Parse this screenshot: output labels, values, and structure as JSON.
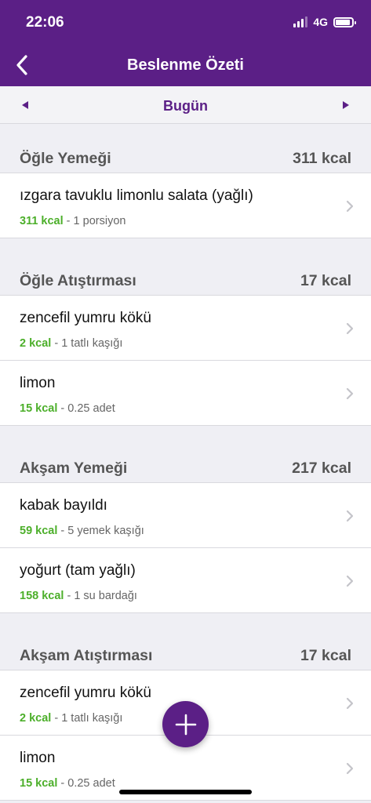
{
  "status_bar": {
    "time": "22:06",
    "network": "4G",
    "battery_level": 0.9
  },
  "nav": {
    "title": "Beslenme Özeti",
    "back_icon": "chevron-left-icon"
  },
  "date_bar": {
    "label": "Bugün",
    "prev_icon": "triangle-left-icon",
    "next_icon": "triangle-right-icon"
  },
  "colors": {
    "primary": "#5b1f86",
    "kcal_green": "#4caf2a",
    "background": "#efeff4"
  },
  "sections": [
    {
      "title": "Öğle Yemeği",
      "kcal": "311 kcal",
      "items": [
        {
          "name": "ızgara tavuklu limonlu salata (yağlı)",
          "kcal": "311 kcal",
          "portion": " - 1 porsiyon"
        }
      ]
    },
    {
      "title": "Öğle Atıştırması",
      "kcal": "17 kcal",
      "items": [
        {
          "name": "zencefil yumru kökü",
          "kcal": "2 kcal",
          "portion": " - 1 tatlı kaşığı"
        },
        {
          "name": "limon",
          "kcal": "15 kcal",
          "portion": " - 0.25 adet"
        }
      ]
    },
    {
      "title": "Akşam Yemeği",
      "kcal": "217 kcal",
      "items": [
        {
          "name": "kabak bayıldı",
          "kcal": "59 kcal",
          "portion": " - 5 yemek kaşığı"
        },
        {
          "name": "yoğurt (tam yağlı)",
          "kcal": "158 kcal",
          "portion": " - 1 su bardağı"
        }
      ]
    },
    {
      "title": "Akşam Atıştırması",
      "kcal": "17 kcal",
      "items": [
        {
          "name": "zencefil yumru kökü",
          "kcal": "2 kcal",
          "portion": " - 1 tatlı kaşığı"
        },
        {
          "name": "limon",
          "kcal": "15 kcal",
          "portion": " - 0.25 adet"
        }
      ]
    }
  ],
  "fab": {
    "icon": "plus-icon"
  }
}
